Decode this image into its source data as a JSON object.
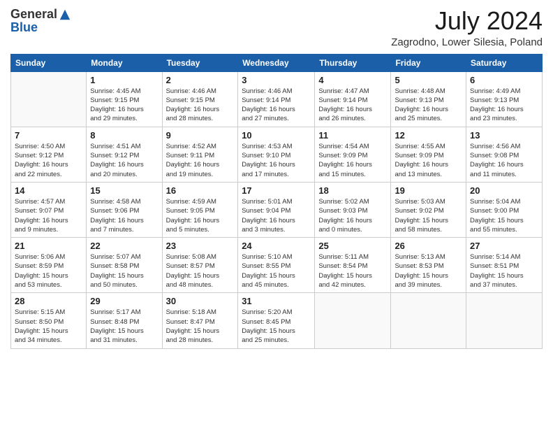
{
  "logo": {
    "general": "General",
    "blue": "Blue"
  },
  "title": "July 2024",
  "location": "Zagrodno, Lower Silesia, Poland",
  "days_of_week": [
    "Sunday",
    "Monday",
    "Tuesday",
    "Wednesday",
    "Thursday",
    "Friday",
    "Saturday"
  ],
  "weeks": [
    [
      {
        "day": "",
        "info": ""
      },
      {
        "day": "1",
        "info": "Sunrise: 4:45 AM\nSunset: 9:15 PM\nDaylight: 16 hours\nand 29 minutes."
      },
      {
        "day": "2",
        "info": "Sunrise: 4:46 AM\nSunset: 9:15 PM\nDaylight: 16 hours\nand 28 minutes."
      },
      {
        "day": "3",
        "info": "Sunrise: 4:46 AM\nSunset: 9:14 PM\nDaylight: 16 hours\nand 27 minutes."
      },
      {
        "day": "4",
        "info": "Sunrise: 4:47 AM\nSunset: 9:14 PM\nDaylight: 16 hours\nand 26 minutes."
      },
      {
        "day": "5",
        "info": "Sunrise: 4:48 AM\nSunset: 9:13 PM\nDaylight: 16 hours\nand 25 minutes."
      },
      {
        "day": "6",
        "info": "Sunrise: 4:49 AM\nSunset: 9:13 PM\nDaylight: 16 hours\nand 23 minutes."
      }
    ],
    [
      {
        "day": "7",
        "info": "Sunrise: 4:50 AM\nSunset: 9:12 PM\nDaylight: 16 hours\nand 22 minutes."
      },
      {
        "day": "8",
        "info": "Sunrise: 4:51 AM\nSunset: 9:12 PM\nDaylight: 16 hours\nand 20 minutes."
      },
      {
        "day": "9",
        "info": "Sunrise: 4:52 AM\nSunset: 9:11 PM\nDaylight: 16 hours\nand 19 minutes."
      },
      {
        "day": "10",
        "info": "Sunrise: 4:53 AM\nSunset: 9:10 PM\nDaylight: 16 hours\nand 17 minutes."
      },
      {
        "day": "11",
        "info": "Sunrise: 4:54 AM\nSunset: 9:09 PM\nDaylight: 16 hours\nand 15 minutes."
      },
      {
        "day": "12",
        "info": "Sunrise: 4:55 AM\nSunset: 9:09 PM\nDaylight: 16 hours\nand 13 minutes."
      },
      {
        "day": "13",
        "info": "Sunrise: 4:56 AM\nSunset: 9:08 PM\nDaylight: 16 hours\nand 11 minutes."
      }
    ],
    [
      {
        "day": "14",
        "info": "Sunrise: 4:57 AM\nSunset: 9:07 PM\nDaylight: 16 hours\nand 9 minutes."
      },
      {
        "day": "15",
        "info": "Sunrise: 4:58 AM\nSunset: 9:06 PM\nDaylight: 16 hours\nand 7 minutes."
      },
      {
        "day": "16",
        "info": "Sunrise: 4:59 AM\nSunset: 9:05 PM\nDaylight: 16 hours\nand 5 minutes."
      },
      {
        "day": "17",
        "info": "Sunrise: 5:01 AM\nSunset: 9:04 PM\nDaylight: 16 hours\nand 3 minutes."
      },
      {
        "day": "18",
        "info": "Sunrise: 5:02 AM\nSunset: 9:03 PM\nDaylight: 16 hours\nand 0 minutes."
      },
      {
        "day": "19",
        "info": "Sunrise: 5:03 AM\nSunset: 9:02 PM\nDaylight: 15 hours\nand 58 minutes."
      },
      {
        "day": "20",
        "info": "Sunrise: 5:04 AM\nSunset: 9:00 PM\nDaylight: 15 hours\nand 55 minutes."
      }
    ],
    [
      {
        "day": "21",
        "info": "Sunrise: 5:06 AM\nSunset: 8:59 PM\nDaylight: 15 hours\nand 53 minutes."
      },
      {
        "day": "22",
        "info": "Sunrise: 5:07 AM\nSunset: 8:58 PM\nDaylight: 15 hours\nand 50 minutes."
      },
      {
        "day": "23",
        "info": "Sunrise: 5:08 AM\nSunset: 8:57 PM\nDaylight: 15 hours\nand 48 minutes."
      },
      {
        "day": "24",
        "info": "Sunrise: 5:10 AM\nSunset: 8:55 PM\nDaylight: 15 hours\nand 45 minutes."
      },
      {
        "day": "25",
        "info": "Sunrise: 5:11 AM\nSunset: 8:54 PM\nDaylight: 15 hours\nand 42 minutes."
      },
      {
        "day": "26",
        "info": "Sunrise: 5:13 AM\nSunset: 8:53 PM\nDaylight: 15 hours\nand 39 minutes."
      },
      {
        "day": "27",
        "info": "Sunrise: 5:14 AM\nSunset: 8:51 PM\nDaylight: 15 hours\nand 37 minutes."
      }
    ],
    [
      {
        "day": "28",
        "info": "Sunrise: 5:15 AM\nSunset: 8:50 PM\nDaylight: 15 hours\nand 34 minutes."
      },
      {
        "day": "29",
        "info": "Sunrise: 5:17 AM\nSunset: 8:48 PM\nDaylight: 15 hours\nand 31 minutes."
      },
      {
        "day": "30",
        "info": "Sunrise: 5:18 AM\nSunset: 8:47 PM\nDaylight: 15 hours\nand 28 minutes."
      },
      {
        "day": "31",
        "info": "Sunrise: 5:20 AM\nSunset: 8:45 PM\nDaylight: 15 hours\nand 25 minutes."
      },
      {
        "day": "",
        "info": ""
      },
      {
        "day": "",
        "info": ""
      },
      {
        "day": "",
        "info": ""
      }
    ]
  ]
}
